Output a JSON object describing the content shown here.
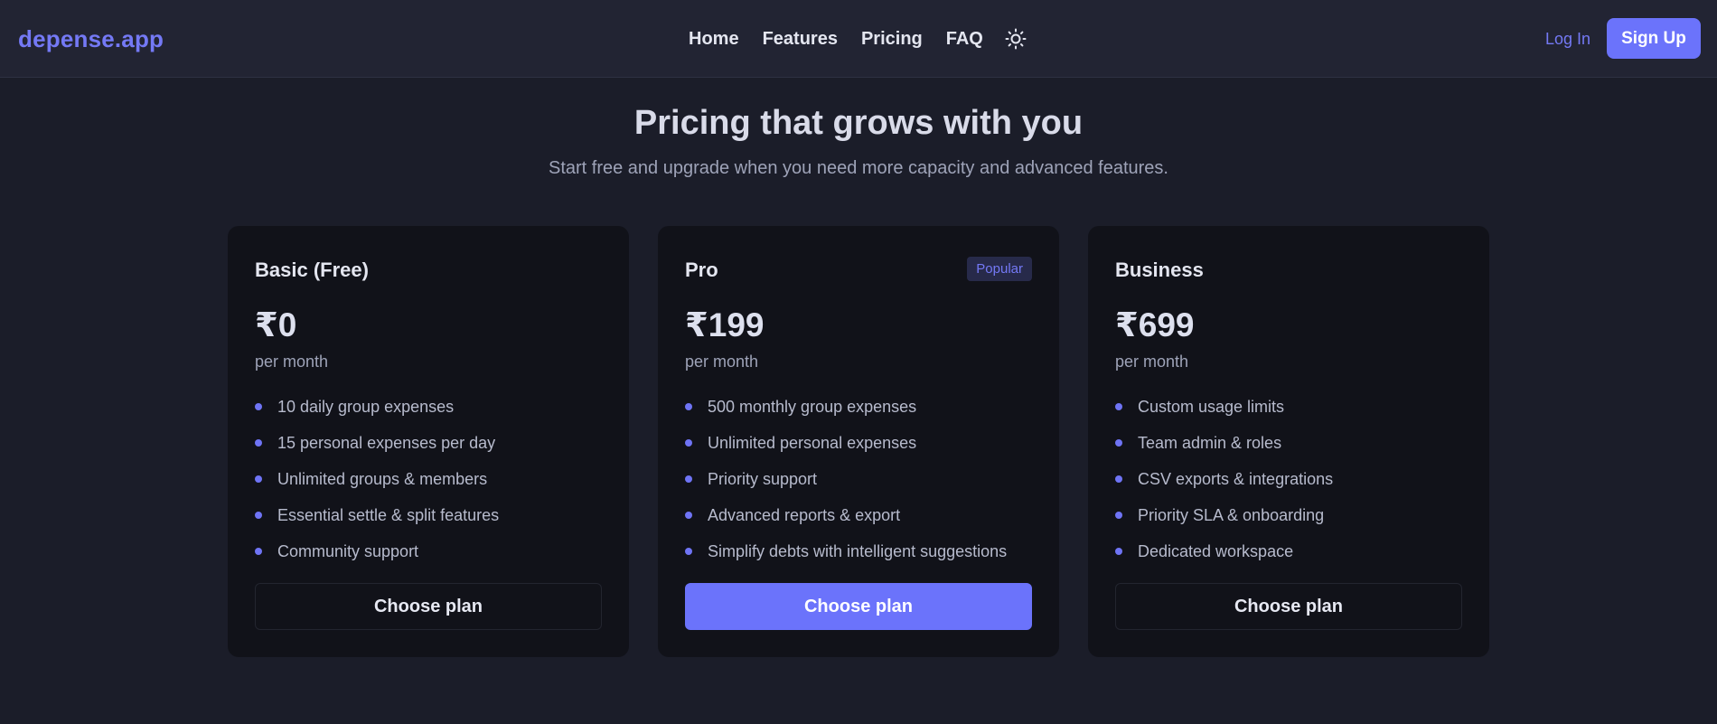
{
  "header": {
    "brand": "depense.app",
    "nav": [
      {
        "label": "Home"
      },
      {
        "label": "Features"
      },
      {
        "label": "Pricing"
      },
      {
        "label": "FAQ"
      }
    ],
    "theme_icon": "sun-icon",
    "login_label": "Log In",
    "signup_label": "Sign Up"
  },
  "hero": {
    "title": "Pricing that grows with you",
    "subtitle": "Start free and upgrade when you need more capacity and advanced features."
  },
  "plans": [
    {
      "name": "Basic (Free)",
      "price": "₹0",
      "period": "per month",
      "badge": "",
      "features": [
        "10 daily group expenses",
        "15 personal expenses per day",
        "Unlimited groups & members",
        "Essential settle & split features",
        "Community support"
      ],
      "cta": "Choose plan"
    },
    {
      "name": "Pro",
      "price": "₹199",
      "period": "per month",
      "badge": "Popular",
      "features": [
        "500 monthly group expenses",
        "Unlimited personal expenses",
        "Priority support",
        "Advanced reports & export",
        "Simplify debts with intelligent suggestions"
      ],
      "cta": "Choose plan"
    },
    {
      "name": "Business",
      "price": "₹699",
      "period": "per month",
      "badge": "",
      "features": [
        "Custom usage limits",
        "Team admin & roles",
        "CSV exports & integrations",
        "Priority SLA & onboarding",
        "Dedicated workspace"
      ],
      "cta": "Choose plan"
    }
  ],
  "colors": {
    "accent": "#6b73fb",
    "brand": "#7479f5",
    "background": "#1b1d29",
    "card": "#111219"
  }
}
